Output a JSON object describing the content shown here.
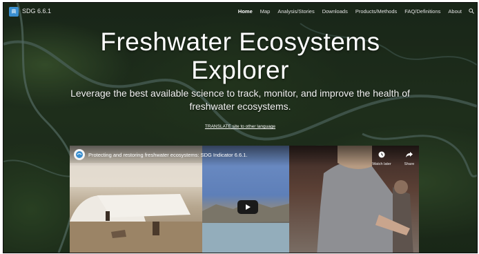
{
  "nav": {
    "brand": "SDG 6.6.1",
    "items": [
      "Home",
      "Map",
      "Analysis/Stories",
      "Downloads",
      "Products/Methods",
      "FAQ/Definitions",
      "About"
    ],
    "active": "Home"
  },
  "hero": {
    "title_line1": "Freshwater Ecosystems",
    "title_line2": "Explorer",
    "subtitle": "Leverage the best available science to track, monitor, and improve the health of freshwater ecosystems.",
    "translate_link": "TRANSLATE site to other language"
  },
  "video": {
    "title": "Protecting and restoring freshwater ecosystems: SDG Indicator 6.6.1.",
    "watch_later_label": "Watch later",
    "share_label": "Share"
  },
  "icons": {
    "logo": "sdg-logo-icon",
    "search": "search-icon",
    "play": "play-icon",
    "watch_later": "clock-icon",
    "share": "share-arrow-icon"
  },
  "colors": {
    "nav_text": "#e4e4e4",
    "logo_blue": "#3a8fd0",
    "play_button": "#1a1a1a"
  }
}
